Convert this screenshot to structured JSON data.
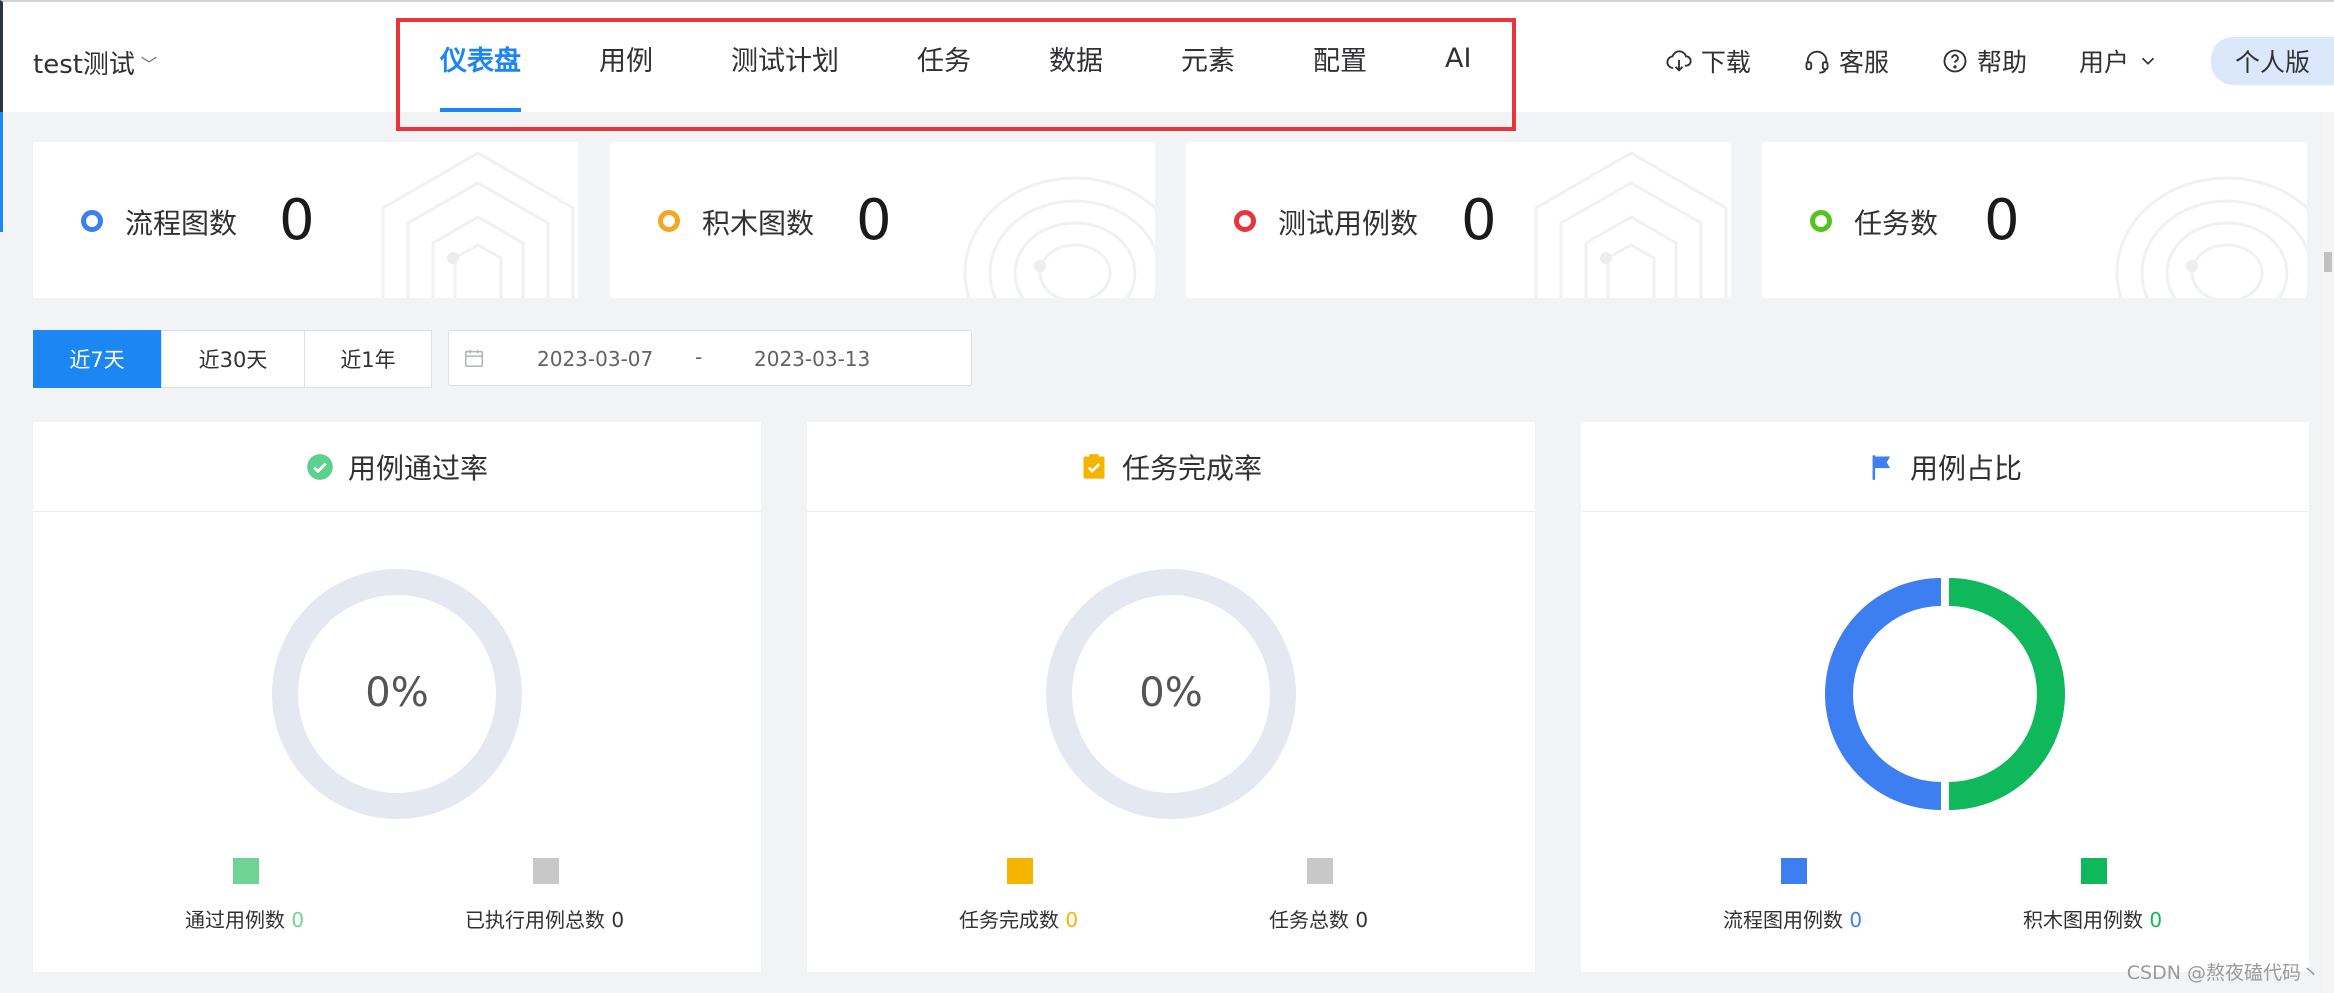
{
  "header": {
    "project": "test测试",
    "nav": [
      "仪表盘",
      "用例",
      "测试计划",
      "任务",
      "数据",
      "元素",
      "配置",
      "AI"
    ],
    "tools": {
      "download": "下载",
      "service": "客服",
      "help": "帮助",
      "user": "用户",
      "personal": "个人版"
    }
  },
  "stats": [
    {
      "label": "流程图数",
      "value": "0",
      "color": "#3b7ff0"
    },
    {
      "label": "积木图数",
      "value": "0",
      "color": "#f5a623"
    },
    {
      "label": "测试用例数",
      "value": "0",
      "color": "#e8343b"
    },
    {
      "label": "任务数",
      "value": "0",
      "color": "#52c41a"
    }
  ],
  "filters": {
    "ranges": [
      "近7天",
      "近30天",
      "近1年"
    ],
    "start_date": "2023-03-07",
    "separator": "-",
    "end_date": "2023-03-13"
  },
  "panels": {
    "pass_rate": {
      "title": "用例通过率",
      "percent": "0%",
      "legend": [
        {
          "label": "通过用例数",
          "value": "0",
          "color": "#6ed496"
        },
        {
          "label": "已执行用例总数",
          "value": "0",
          "color": "#c8c8c8"
        }
      ]
    },
    "task_rate": {
      "title": "任务完成率",
      "percent": "0%",
      "legend": [
        {
          "label": "任务完成数",
          "value": "0",
          "color": "#f5b400"
        },
        {
          "label": "任务总数",
          "value": "0",
          "color": "#c8c8c8"
        }
      ]
    },
    "case_ratio": {
      "title": "用例占比",
      "legend": [
        {
          "label": "流程图用例数",
          "value": "0",
          "color": "#3d7ff0"
        },
        {
          "label": "积木图用例数",
          "value": "0",
          "color": "#0fb85a"
        }
      ]
    }
  },
  "watermark": "CSDN @熬夜磕代码丶"
}
